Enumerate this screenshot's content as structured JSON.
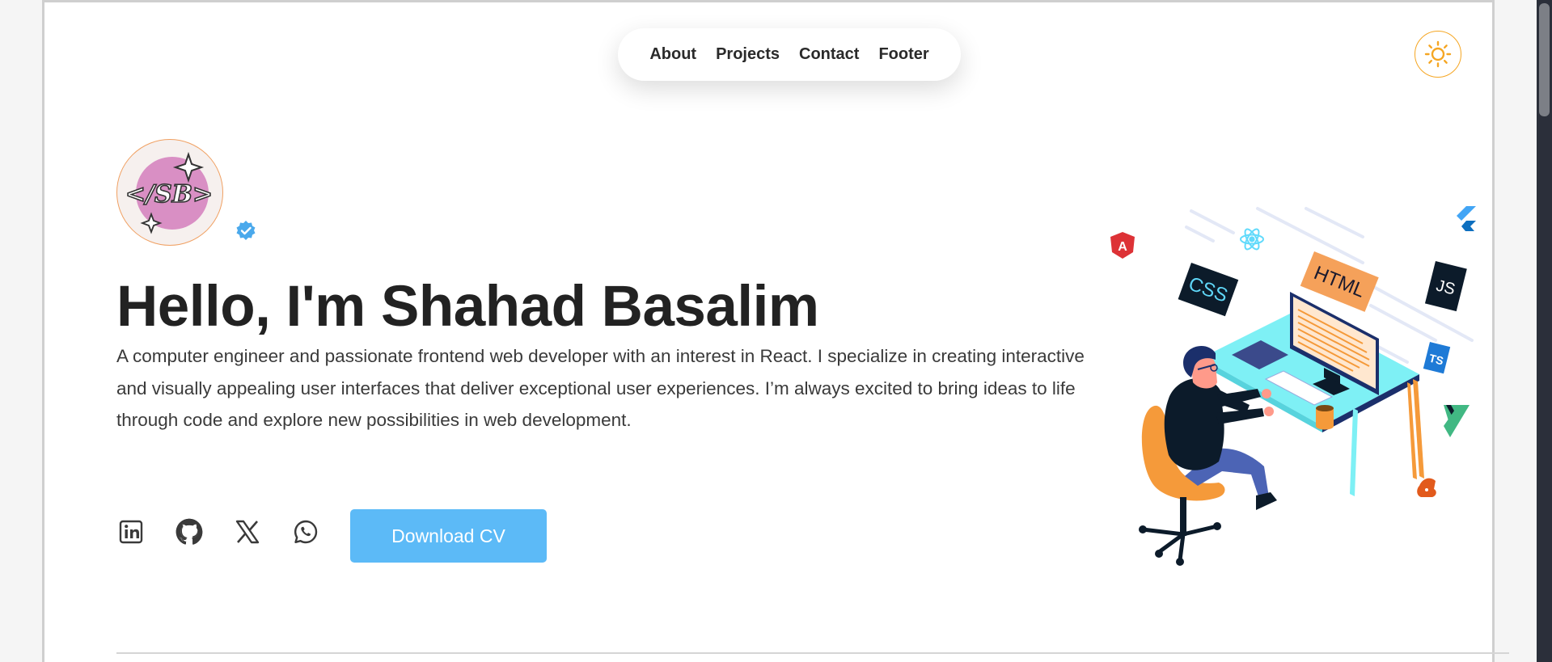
{
  "nav": {
    "items": [
      {
        "label": "About"
      },
      {
        "label": "Projects"
      },
      {
        "label": "Contact"
      },
      {
        "label": "Footer"
      }
    ]
  },
  "theme_toggle": {
    "icon": "sun-icon",
    "color": "#f5a623"
  },
  "hero": {
    "avatar_logo_text": "</SB>",
    "verified_icon": "verified-badge-icon",
    "title": "Hello, I'm Shahad Basalim",
    "intro": "A computer engineer and passionate frontend web developer with an interest in React. I specialize in creating interactive and visually appealing user interfaces that deliver exceptional user experiences. I’m always excited to bring ideas to life through code and explore new possibilities in web development.",
    "socials": [
      {
        "icon": "linkedin-icon"
      },
      {
        "icon": "github-icon"
      },
      {
        "icon": "x-icon"
      },
      {
        "icon": "whatsapp-icon"
      }
    ],
    "cv_button_label": "Download CV",
    "cv_button_color": "#5cbaf7"
  },
  "illustration": {
    "badges": {
      "css": "CSS",
      "html": "HTML",
      "js": "JS",
      "ts": "TS"
    }
  }
}
